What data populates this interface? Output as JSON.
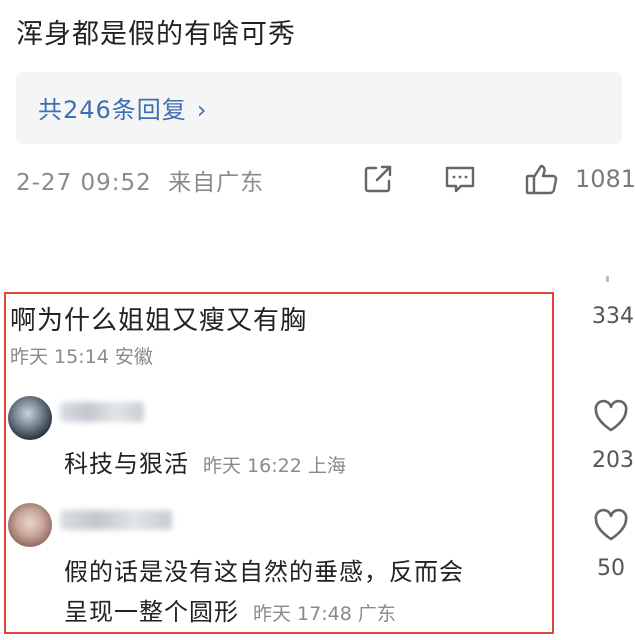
{
  "top_comment": {
    "text": "浑身都是假的有啥可秀",
    "replies_link": "共246条回复",
    "timestamp": "2-27 09:52",
    "location": "来自广东",
    "like_count": "1081",
    "icons": [
      "share-icon",
      "comment-icon",
      "thumbs-up-icon"
    ]
  },
  "comment2": {
    "text": "啊为什么姐姐又瘦又有胸",
    "meta": "昨天 15:14 安徽",
    "like_count": "334"
  },
  "reply1": {
    "text": "科技与狠活",
    "meta": "昨天 16:22 上海",
    "like_count": "203"
  },
  "reply2": {
    "line1": "假的话是没有这自然的垂感，反而会",
    "line2": "呈现一整个圆形",
    "meta": "昨天 17:48 广东",
    "like_count": "50"
  },
  "colors": {
    "link": "#3f6fb0",
    "highlight_border": "#e0453a",
    "meta_gray": "#8a8a8a"
  }
}
